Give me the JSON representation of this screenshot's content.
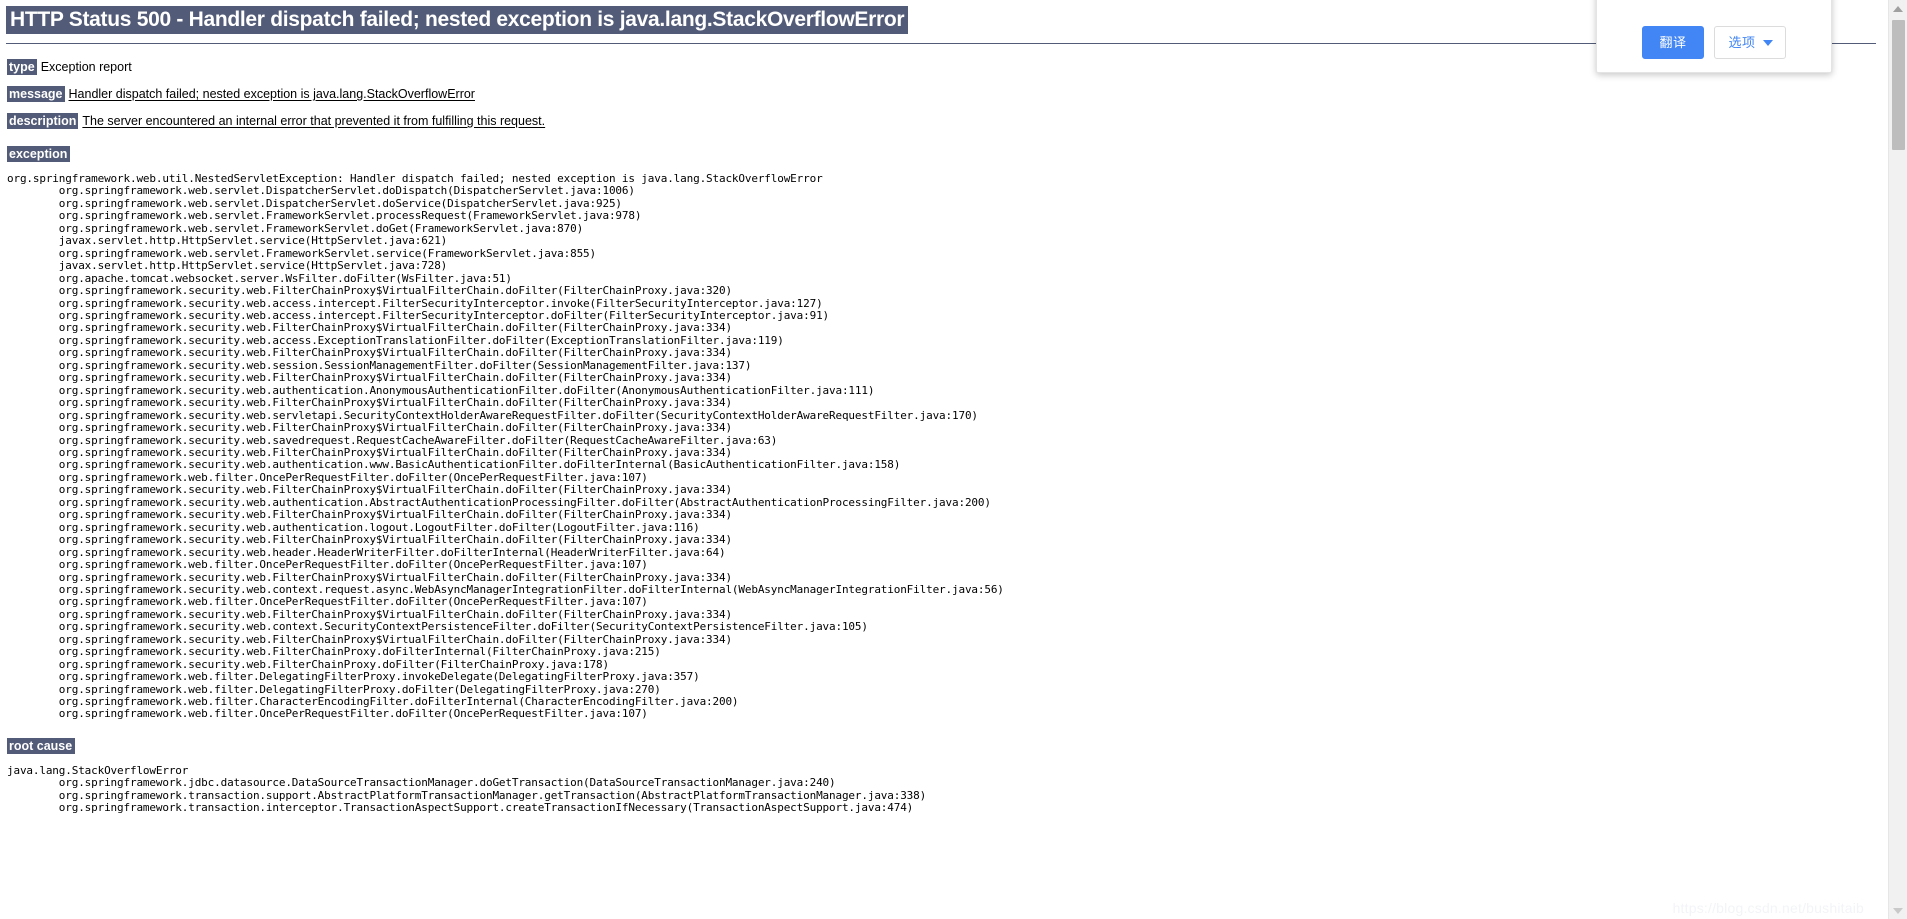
{
  "page": {
    "title": "HTTP Status 500 - Handler dispatch failed; nested exception is java.lang.StackOverflowError",
    "watermark": "https://blog.csdn.net/bushitaib"
  },
  "meta": {
    "type_label": "type",
    "type_value": "Exception report",
    "message_label": "message",
    "message_value": "Handler dispatch failed; nested exception is java.lang.StackOverflowError",
    "description_label": "description",
    "description_value": "The server encountered an internal error that prevented it from fulfilling this request."
  },
  "sections": {
    "exception_label": "exception",
    "exception_trace": "org.springframework.web.util.NestedServletException: Handler dispatch failed; nested exception is java.lang.StackOverflowError\n        org.springframework.web.servlet.DispatcherServlet.doDispatch(DispatcherServlet.java:1006)\n        org.springframework.web.servlet.DispatcherServlet.doService(DispatcherServlet.java:925)\n        org.springframework.web.servlet.FrameworkServlet.processRequest(FrameworkServlet.java:978)\n        org.springframework.web.servlet.FrameworkServlet.doGet(FrameworkServlet.java:870)\n        javax.servlet.http.HttpServlet.service(HttpServlet.java:621)\n        org.springframework.web.servlet.FrameworkServlet.service(FrameworkServlet.java:855)\n        javax.servlet.http.HttpServlet.service(HttpServlet.java:728)\n        org.apache.tomcat.websocket.server.WsFilter.doFilter(WsFilter.java:51)\n        org.springframework.security.web.FilterChainProxy$VirtualFilterChain.doFilter(FilterChainProxy.java:320)\n        org.springframework.security.web.access.intercept.FilterSecurityInterceptor.invoke(FilterSecurityInterceptor.java:127)\n        org.springframework.security.web.access.intercept.FilterSecurityInterceptor.doFilter(FilterSecurityInterceptor.java:91)\n        org.springframework.security.web.FilterChainProxy$VirtualFilterChain.doFilter(FilterChainProxy.java:334)\n        org.springframework.security.web.access.ExceptionTranslationFilter.doFilter(ExceptionTranslationFilter.java:119)\n        org.springframework.security.web.FilterChainProxy$VirtualFilterChain.doFilter(FilterChainProxy.java:334)\n        org.springframework.security.web.session.SessionManagementFilter.doFilter(SessionManagementFilter.java:137)\n        org.springframework.security.web.FilterChainProxy$VirtualFilterChain.doFilter(FilterChainProxy.java:334)\n        org.springframework.security.web.authentication.AnonymousAuthenticationFilter.doFilter(AnonymousAuthenticationFilter.java:111)\n        org.springframework.security.web.FilterChainProxy$VirtualFilterChain.doFilter(FilterChainProxy.java:334)\n        org.springframework.security.web.servletapi.SecurityContextHolderAwareRequestFilter.doFilter(SecurityContextHolderAwareRequestFilter.java:170)\n        org.springframework.security.web.FilterChainProxy$VirtualFilterChain.doFilter(FilterChainProxy.java:334)\n        org.springframework.security.web.savedrequest.RequestCacheAwareFilter.doFilter(RequestCacheAwareFilter.java:63)\n        org.springframework.security.web.FilterChainProxy$VirtualFilterChain.doFilter(FilterChainProxy.java:334)\n        org.springframework.security.web.authentication.www.BasicAuthenticationFilter.doFilterInternal(BasicAuthenticationFilter.java:158)\n        org.springframework.web.filter.OncePerRequestFilter.doFilter(OncePerRequestFilter.java:107)\n        org.springframework.security.web.FilterChainProxy$VirtualFilterChain.doFilter(FilterChainProxy.java:334)\n        org.springframework.security.web.authentication.AbstractAuthenticationProcessingFilter.doFilter(AbstractAuthenticationProcessingFilter.java:200)\n        org.springframework.security.web.FilterChainProxy$VirtualFilterChain.doFilter(FilterChainProxy.java:334)\n        org.springframework.security.web.authentication.logout.LogoutFilter.doFilter(LogoutFilter.java:116)\n        org.springframework.security.web.FilterChainProxy$VirtualFilterChain.doFilter(FilterChainProxy.java:334)\n        org.springframework.security.web.header.HeaderWriterFilter.doFilterInternal(HeaderWriterFilter.java:64)\n        org.springframework.web.filter.OncePerRequestFilter.doFilter(OncePerRequestFilter.java:107)\n        org.springframework.security.web.FilterChainProxy$VirtualFilterChain.doFilter(FilterChainProxy.java:334)\n        org.springframework.security.web.context.request.async.WebAsyncManagerIntegrationFilter.doFilterInternal(WebAsyncManagerIntegrationFilter.java:56)\n        org.springframework.web.filter.OncePerRequestFilter.doFilter(OncePerRequestFilter.java:107)\n        org.springframework.security.web.FilterChainProxy$VirtualFilterChain.doFilter(FilterChainProxy.java:334)\n        org.springframework.security.web.context.SecurityContextPersistenceFilter.doFilter(SecurityContextPersistenceFilter.java:105)\n        org.springframework.security.web.FilterChainProxy$VirtualFilterChain.doFilter(FilterChainProxy.java:334)\n        org.springframework.security.web.FilterChainProxy.doFilterInternal(FilterChainProxy.java:215)\n        org.springframework.security.web.FilterChainProxy.doFilter(FilterChainProxy.java:178)\n        org.springframework.web.filter.DelegatingFilterProxy.invokeDelegate(DelegatingFilterProxy.java:357)\n        org.springframework.web.filter.DelegatingFilterProxy.doFilter(DelegatingFilterProxy.java:270)\n        org.springframework.web.filter.CharacterEncodingFilter.doFilterInternal(CharacterEncodingFilter.java:200)\n        org.springframework.web.filter.OncePerRequestFilter.doFilter(OncePerRequestFilter.java:107)",
    "root_cause_label": "root cause",
    "root_cause_trace": "java.lang.StackOverflowError\n        org.springframework.jdbc.datasource.DataSourceTransactionManager.doGetTransaction(DataSourceTransactionManager.java:240)\n        org.springframework.transaction.support.AbstractPlatformTransactionManager.getTransaction(AbstractPlatformTransactionManager.java:338)\n        org.springframework.transaction.interceptor.TransactionAspectSupport.createTransactionIfNecessary(TransactionAspectSupport.java:474)"
  },
  "translate_popup": {
    "translate_label": "翻译",
    "options_label": "选项",
    "caret_icon": "chevron-down-icon",
    "accent_color": "#4285f4"
  },
  "scrollbar": {
    "up_icon": "scroll-up-arrow-icon",
    "down_icon": "scroll-down-arrow-icon"
  }
}
